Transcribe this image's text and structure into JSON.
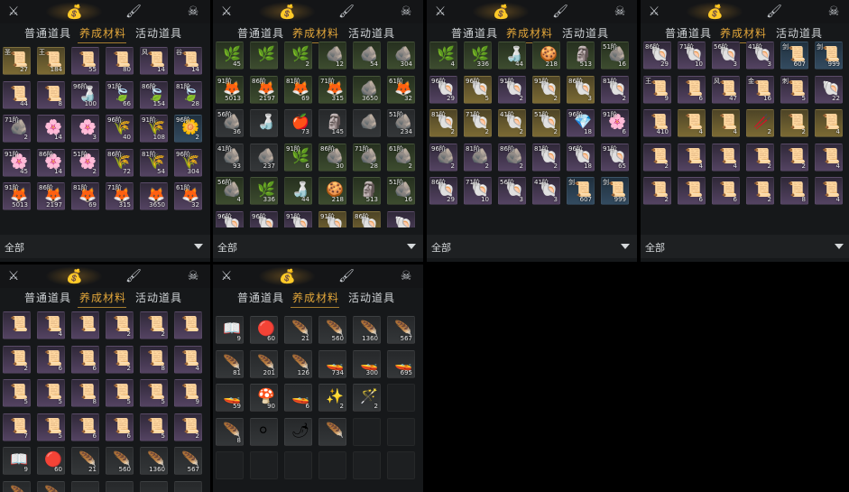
{
  "icons": {
    "weapons": "crossed-swords",
    "bag": "money-bag",
    "tool": "brush",
    "profile": "skull"
  },
  "colors": {
    "accent": "#e2a63a",
    "panel": "#16181a",
    "text": "#cfd3d6"
  },
  "tabs": [
    "普通道具",
    "养成材料",
    "活动道具"
  ],
  "filter_label": "全部",
  "panels": [
    {
      "id": "p1",
      "cells": [
        {
          "c": "gold",
          "g": "📜",
          "r": "圣",
          "n": "27"
        },
        {
          "c": "gold",
          "g": "📜",
          "r": "王",
          "n": "184"
        },
        {
          "c": "purple",
          "g": "📜",
          "n": "55"
        },
        {
          "c": "purple",
          "g": "📜",
          "n": "80"
        },
        {
          "c": "purple",
          "g": "📜",
          "r": "风",
          "n": "14"
        },
        {
          "c": "purple",
          "g": "📜",
          "r": "谷",
          "n": "14"
        },
        {
          "c": "purple",
          "g": "📜",
          "n": "44"
        },
        {
          "c": "purple",
          "g": "📜",
          "n": "8"
        },
        {
          "c": "purple",
          "g": "🍶",
          "r": "96阶",
          "n": "100"
        },
        {
          "c": "purple",
          "g": "🍃",
          "r": "91阶",
          "n": "66"
        },
        {
          "c": "purple",
          "g": "🍃",
          "r": "86阶",
          "n": "154"
        },
        {
          "c": "purple",
          "g": "🍃",
          "r": "81阶",
          "n": "28"
        },
        {
          "c": "purple",
          "g": "🪨",
          "r": "71阶",
          "n": "2"
        },
        {
          "c": "purple",
          "g": "🌸",
          "n": "14"
        },
        {
          "c": "purple",
          "g": "🌸",
          "n": "3"
        },
        {
          "c": "purple",
          "g": "🌾",
          "r": "96阶",
          "n": "40"
        },
        {
          "c": "purple",
          "g": "🌾",
          "r": "91阶",
          "n": "108"
        },
        {
          "c": "blue",
          "g": "🌼",
          "r": "96阶",
          "n": "2"
        },
        {
          "c": "purple",
          "g": "🌸",
          "r": "91阶",
          "n": "45"
        },
        {
          "c": "purple",
          "g": "🌸",
          "r": "86阶",
          "n": "14"
        },
        {
          "c": "purple",
          "g": "🌸",
          "r": "51阶",
          "n": "2"
        },
        {
          "c": "purple",
          "g": "🌾",
          "r": "86阶",
          "n": "72"
        },
        {
          "c": "purple",
          "g": "🌾",
          "r": "81阶",
          "n": "54"
        },
        {
          "c": "purple",
          "g": "🌾",
          "r": "96阶",
          "n": "304"
        },
        {
          "c": "purple",
          "g": "🦊",
          "r": "91阶",
          "n": "5013"
        },
        {
          "c": "purple",
          "g": "🦊",
          "r": "86阶",
          "n": "2197"
        },
        {
          "c": "purple",
          "g": "🦊",
          "r": "81阶",
          "n": "69"
        },
        {
          "c": "purple",
          "g": "🦊",
          "r": "71阶",
          "n": "315"
        },
        {
          "c": "purple",
          "g": "🦊",
          "n": "3650"
        },
        {
          "c": "purple",
          "g": "🦊",
          "r": "61阶",
          "n": "32"
        }
      ]
    },
    {
      "id": "p2",
      "cells": [
        {
          "c": "green",
          "g": "🌿",
          "n": "45"
        },
        {
          "c": "green",
          "g": "🌿",
          "n": ""
        },
        {
          "c": "green",
          "g": "🌿",
          "n": "2"
        },
        {
          "c": "green",
          "g": "🪨",
          "n": "12"
        },
        {
          "c": "green",
          "g": "🪨",
          "n": "54"
        },
        {
          "c": "green",
          "g": "🪨",
          "n": "304"
        },
        {
          "c": "green",
          "g": "🦊",
          "r": "91阶",
          "n": "5013"
        },
        {
          "c": "green",
          "g": "🦊",
          "r": "86阶",
          "n": "2197"
        },
        {
          "c": "green",
          "g": "🦊",
          "r": "81阶",
          "n": "69"
        },
        {
          "c": "green",
          "g": "🦊",
          "r": "71阶",
          "n": "315"
        },
        {
          "c": "green",
          "g": "🪨",
          "n": "3650"
        },
        {
          "c": "green",
          "g": "🦊",
          "r": "61阶",
          "n": "32"
        },
        {
          "c": "grey",
          "g": "🪨",
          "r": "56阶",
          "n": "36"
        },
        {
          "c": "grey",
          "g": "🍶",
          "n": ""
        },
        {
          "c": "grey",
          "g": "🍎",
          "n": "73"
        },
        {
          "c": "grey",
          "g": "🗿",
          "n": "145"
        },
        {
          "c": "grey",
          "g": "🪨",
          "n": ""
        },
        {
          "c": "grey",
          "g": "🪨",
          "r": "51阶",
          "n": "234"
        },
        {
          "c": "grey",
          "g": "🪨",
          "r": "41阶",
          "n": "93"
        },
        {
          "c": "grey",
          "g": "🪨",
          "n": "237"
        },
        {
          "c": "green",
          "g": "🌿",
          "r": "91阶",
          "n": "6"
        },
        {
          "c": "green",
          "g": "🪨",
          "r": "86阶",
          "n": "30"
        },
        {
          "c": "green",
          "g": "🪨",
          "r": "71阶",
          "n": "28"
        },
        {
          "c": "green",
          "g": "🪨",
          "r": "61阶",
          "n": "2"
        },
        {
          "c": "green",
          "g": "🪨",
          "r": "56阶",
          "n": "4"
        },
        {
          "c": "green",
          "g": "🌿",
          "n": "336"
        },
        {
          "c": "green",
          "g": "🍶",
          "n": "44"
        },
        {
          "c": "green",
          "g": "🍪",
          "n": "218"
        },
        {
          "c": "green",
          "g": "🗿",
          "n": "513"
        },
        {
          "c": "green",
          "g": "🪨",
          "r": "51阶",
          "n": "16"
        },
        {
          "c": "purple",
          "g": "🐚",
          "r": "96阶",
          "n": ""
        },
        {
          "c": "purple",
          "g": "🐚",
          "r": "96阶",
          "n": ""
        },
        {
          "c": "purple",
          "g": "🐚",
          "r": "91阶",
          "n": ""
        },
        {
          "c": "gold",
          "g": "🐚",
          "r": "91阶",
          "n": ""
        },
        {
          "c": "gold",
          "g": "🐚",
          "r": "86阶",
          "n": ""
        },
        {
          "c": "purple",
          "g": "🐚",
          "n": ""
        }
      ]
    },
    {
      "id": "p3",
      "cells": [
        {
          "c": "green",
          "g": "🌿",
          "n": "4"
        },
        {
          "c": "green",
          "g": "🌿",
          "n": "336"
        },
        {
          "c": "green",
          "g": "🍶",
          "n": "44"
        },
        {
          "c": "green",
          "g": "🍪",
          "n": "218"
        },
        {
          "c": "green",
          "g": "🗿",
          "n": "513"
        },
        {
          "c": "green",
          "g": "🪨",
          "r": "51阶",
          "n": "16"
        },
        {
          "c": "purple",
          "g": "🐚",
          "r": "96阶",
          "n": "29"
        },
        {
          "c": "gold",
          "g": "🐚",
          "r": "96阶",
          "n": "5"
        },
        {
          "c": "purple",
          "g": "🐚",
          "r": "91阶",
          "n": "2"
        },
        {
          "c": "gold",
          "g": "🐚",
          "r": "91阶",
          "n": "2"
        },
        {
          "c": "gold",
          "g": "🐚",
          "r": "86阶",
          "n": "3"
        },
        {
          "c": "purple",
          "g": "🐚",
          "r": "81阶",
          "n": "2"
        },
        {
          "c": "gold",
          "g": "🐚",
          "r": "81阶",
          "n": "2"
        },
        {
          "c": "gold",
          "g": "🐚",
          "r": "71阶",
          "n": "2"
        },
        {
          "c": "gold",
          "g": "🐚",
          "r": "41阶",
          "n": "2"
        },
        {
          "c": "gold",
          "g": "🐚",
          "r": "51阶",
          "n": "2"
        },
        {
          "c": "purple",
          "g": "💎",
          "r": "96阶",
          "n": "18"
        },
        {
          "c": "purple",
          "g": "🌸",
          "r": "91阶",
          "n": "6"
        },
        {
          "c": "purple",
          "g": "🪨",
          "r": "96阶",
          "n": "2"
        },
        {
          "c": "purple",
          "g": "🪨",
          "r": "81阶",
          "n": "2"
        },
        {
          "c": "purple",
          "g": "🪨",
          "r": "86阶",
          "n": "2"
        },
        {
          "c": "purple",
          "g": "🐚",
          "r": "81阶",
          "n": "2"
        },
        {
          "c": "purple",
          "g": "🐚",
          "r": "96阶",
          "n": "18"
        },
        {
          "c": "purple",
          "g": "🐚",
          "r": "91阶",
          "n": "65"
        },
        {
          "c": "purple",
          "g": "🐚",
          "r": "86阶",
          "n": "29"
        },
        {
          "c": "purple",
          "g": "🐚",
          "r": "71阶",
          "n": "10"
        },
        {
          "c": "purple",
          "g": "🐚",
          "r": "56阶",
          "n": "3"
        },
        {
          "c": "purple",
          "g": "🐚",
          "r": "41阶",
          "n": "3"
        },
        {
          "c": "blue",
          "g": "📜",
          "r": "剑",
          "n": "607"
        },
        {
          "c": "blue",
          "g": "📜",
          "r": "剑",
          "n": "999"
        }
      ]
    },
    {
      "id": "p4",
      "cells": [
        {
          "c": "purple",
          "g": "🐚",
          "r": "86阶",
          "n": "29"
        },
        {
          "c": "purple",
          "g": "🐚",
          "r": "71阶",
          "n": "10"
        },
        {
          "c": "purple",
          "g": "🐚",
          "r": "56阶",
          "n": "3"
        },
        {
          "c": "purple",
          "g": "🐚",
          "r": "41阶",
          "n": "3"
        },
        {
          "c": "blue",
          "g": "📜",
          "r": "剑",
          "n": "607"
        },
        {
          "c": "blue",
          "g": "📜",
          "r": "剑",
          "n": "999"
        },
        {
          "c": "purple",
          "g": "📜",
          "r": "王",
          "n": "9"
        },
        {
          "c": "purple",
          "g": "📜",
          "n": "6"
        },
        {
          "c": "purple",
          "g": "📜",
          "r": "风",
          "n": "47"
        },
        {
          "c": "purple",
          "g": "📜",
          "r": "金",
          "n": "16"
        },
        {
          "c": "purple",
          "g": "📜",
          "r": "刺",
          "n": "5"
        },
        {
          "c": "purple",
          "g": "🐚",
          "n": "22"
        },
        {
          "c": "purple",
          "g": "📜",
          "n": "410"
        },
        {
          "c": "gold",
          "g": "📜",
          "n": "4"
        },
        {
          "c": "gold",
          "g": "📜",
          "n": "4"
        },
        {
          "c": "gold",
          "g": "🥢",
          "n": "2"
        },
        {
          "c": "gold",
          "g": "📜",
          "n": "2"
        },
        {
          "c": "gold",
          "g": "📜",
          "n": "4"
        },
        {
          "c": "purple",
          "g": "📜",
          "n": "2"
        },
        {
          "c": "purple",
          "g": "📜",
          "n": "4"
        },
        {
          "c": "purple",
          "g": "📜",
          "n": "4"
        },
        {
          "c": "purple",
          "g": "📜",
          "n": "2"
        },
        {
          "c": "purple",
          "g": "📜",
          "n": "2"
        },
        {
          "c": "purple",
          "g": "📜",
          "n": "4"
        },
        {
          "c": "purple",
          "g": "📜",
          "n": "2"
        },
        {
          "c": "purple",
          "g": "📜",
          "n": "6"
        },
        {
          "c": "purple",
          "g": "📜",
          "n": "6"
        },
        {
          "c": "purple",
          "g": "📜",
          "n": "2"
        },
        {
          "c": "purple",
          "g": "📜",
          "n": "8"
        },
        {
          "c": "purple",
          "g": "📜",
          "n": "4"
        }
      ]
    },
    {
      "id": "p5",
      "cells": [
        {
          "c": "purple",
          "g": "📜",
          "n": ""
        },
        {
          "c": "purple",
          "g": "📜",
          "n": "4"
        },
        {
          "c": "purple",
          "g": "📜",
          "n": ""
        },
        {
          "c": "purple",
          "g": "📜",
          "n": "2"
        },
        {
          "c": "purple",
          "g": "📜",
          "n": "2"
        },
        {
          "c": "purple",
          "g": "📜",
          "n": ""
        },
        {
          "c": "purple",
          "g": "📜",
          "n": "2"
        },
        {
          "c": "purple",
          "g": "📜",
          "n": "6"
        },
        {
          "c": "purple",
          "g": "📜",
          "n": "6"
        },
        {
          "c": "purple",
          "g": "📜",
          "n": "2"
        },
        {
          "c": "purple",
          "g": "📜",
          "n": "8"
        },
        {
          "c": "purple",
          "g": "📜",
          "n": "4"
        },
        {
          "c": "purple",
          "g": "📜",
          "n": "5"
        },
        {
          "c": "purple",
          "g": "📜",
          "n": "5"
        },
        {
          "c": "purple",
          "g": "📜",
          "n": "8"
        },
        {
          "c": "purple",
          "g": "📜",
          "n": "5"
        },
        {
          "c": "purple",
          "g": "📜",
          "n": "5"
        },
        {
          "c": "purple",
          "g": "📜",
          "n": "9"
        },
        {
          "c": "purple",
          "g": "📜",
          "n": "7"
        },
        {
          "c": "purple",
          "g": "📜",
          "n": "5"
        },
        {
          "c": "purple",
          "g": "📜",
          "n": "6"
        },
        {
          "c": "purple",
          "g": "📜",
          "n": "6"
        },
        {
          "c": "purple",
          "g": "📜",
          "n": "5"
        },
        {
          "c": "purple",
          "g": "📜",
          "n": "2"
        },
        {
          "c": "grey",
          "g": "📖",
          "n": "9"
        },
        {
          "c": "grey",
          "g": "🔴",
          "n": "60"
        },
        {
          "c": "grey",
          "g": "🪶",
          "n": "21"
        },
        {
          "c": "grey",
          "g": "🪶",
          "n": "560"
        },
        {
          "c": "grey",
          "g": "🪶",
          "n": "1360"
        },
        {
          "c": "grey",
          "g": "🪶",
          "n": "567"
        },
        {
          "c": "grey",
          "g": "🪶",
          "n": ""
        },
        {
          "c": "grey",
          "g": "🪶",
          "n": ""
        },
        {
          "c": "grey",
          "g": "🚤",
          "n": ""
        },
        {
          "c": "grey",
          "g": "🚤",
          "n": ""
        },
        {
          "c": "grey",
          "g": "🚤",
          "n": ""
        },
        {
          "c": "grey",
          "g": "🚤",
          "n": ""
        }
      ]
    },
    {
      "id": "p6",
      "cells": [
        {
          "c": "grey",
          "g": "📖",
          "n": "9"
        },
        {
          "c": "grey",
          "g": "🔴",
          "n": "60"
        },
        {
          "c": "grey",
          "g": "🪶",
          "n": "21"
        },
        {
          "c": "grey",
          "g": "🪶",
          "n": "560"
        },
        {
          "c": "grey",
          "g": "🪶",
          "n": "1360"
        },
        {
          "c": "grey",
          "g": "🪶",
          "n": "567"
        },
        {
          "c": "grey",
          "g": "🪶",
          "n": "81"
        },
        {
          "c": "grey",
          "g": "🪶",
          "n": "201"
        },
        {
          "c": "grey",
          "g": "🪶",
          "n": "126"
        },
        {
          "c": "grey",
          "g": "🚤",
          "n": "734"
        },
        {
          "c": "grey",
          "g": "🚤",
          "n": "300"
        },
        {
          "c": "grey",
          "g": "🚤",
          "n": "695"
        },
        {
          "c": "grey",
          "g": "🚤",
          "n": "59"
        },
        {
          "c": "grey",
          "g": "🍄",
          "n": "90"
        },
        {
          "c": "grey",
          "g": "🚤",
          "n": "6"
        },
        {
          "c": "grey",
          "g": "✨",
          "n": "2"
        },
        {
          "c": "grey",
          "g": "🪄",
          "n": "2"
        },
        {
          "c": "empty",
          "g": "",
          "n": ""
        },
        {
          "c": "grey",
          "g": "🪶",
          "n": "8"
        },
        {
          "c": "grey",
          "g": "⚪",
          "n": ""
        },
        {
          "c": "grey",
          "g": "🌶",
          "n": ""
        },
        {
          "c": "grey",
          "g": "🪶",
          "n": ""
        },
        {
          "c": "empty",
          "g": "",
          "n": ""
        },
        {
          "c": "empty",
          "g": "",
          "n": ""
        },
        {
          "c": "empty",
          "g": "",
          "n": ""
        },
        {
          "c": "empty",
          "g": "",
          "n": ""
        },
        {
          "c": "empty",
          "g": "",
          "n": ""
        },
        {
          "c": "empty",
          "g": "",
          "n": ""
        },
        {
          "c": "empty",
          "g": "",
          "n": ""
        },
        {
          "c": "empty",
          "g": "",
          "n": ""
        }
      ]
    }
  ]
}
